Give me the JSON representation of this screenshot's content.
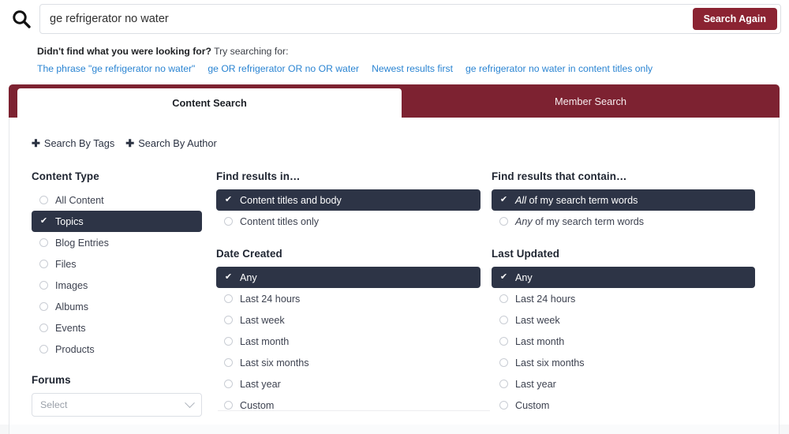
{
  "search": {
    "icon": "search-icon",
    "value": "ge refrigerator no water",
    "placeholder": "Search...",
    "button_label": "Search Again"
  },
  "alt_search": {
    "lead_bold": "Didn't find what you were looking for?",
    "lead_rest": " Try searching for:",
    "links": [
      "The phrase \"ge refrigerator no water\"",
      "ge OR refrigerator OR no OR water",
      "Newest results first",
      "ge refrigerator no water in content titles only"
    ]
  },
  "tabs": [
    {
      "label": "Content Search",
      "active": true
    },
    {
      "label": "Member Search",
      "active": false
    }
  ],
  "quick_links": [
    {
      "icon": "plus-icon",
      "label": "Search By Tags"
    },
    {
      "icon": "plus-icon",
      "label": "Search By Author"
    }
  ],
  "content_type": {
    "title": "Content Type",
    "options": [
      {
        "label": "All Content",
        "selected": false
      },
      {
        "label": "Topics",
        "selected": true
      },
      {
        "label": "Blog Entries",
        "selected": false
      },
      {
        "label": "Files",
        "selected": false
      },
      {
        "label": "Images",
        "selected": false
      },
      {
        "label": "Albums",
        "selected": false
      },
      {
        "label": "Events",
        "selected": false
      },
      {
        "label": "Products",
        "selected": false
      }
    ]
  },
  "forums": {
    "title": "Forums",
    "select_placeholder": "Select",
    "chevron": "chevron-down-icon"
  },
  "find_results_in": {
    "title": "Find results in…",
    "options": [
      {
        "label": "Content titles and body",
        "selected": true
      },
      {
        "label": "Content titles only",
        "selected": false
      }
    ]
  },
  "date_created": {
    "title": "Date Created",
    "options": [
      {
        "label": "Any",
        "selected": true
      },
      {
        "label": "Last 24 hours",
        "selected": false
      },
      {
        "label": "Last week",
        "selected": false
      },
      {
        "label": "Last month",
        "selected": false
      },
      {
        "label": "Last six months",
        "selected": false
      },
      {
        "label": "Last year",
        "selected": false
      },
      {
        "label": "Custom",
        "selected": false
      }
    ]
  },
  "find_results_contain": {
    "title": "Find results that contain…",
    "options": [
      {
        "em": "All",
        "rest": " of my search term words",
        "selected": true
      },
      {
        "em": "Any",
        "rest": " of my search term words",
        "selected": false
      }
    ]
  },
  "last_updated": {
    "title": "Last Updated",
    "options": [
      {
        "label": "Any",
        "selected": true
      },
      {
        "label": "Last 24 hours",
        "selected": false
      },
      {
        "label": "Last week",
        "selected": false
      },
      {
        "label": "Last month",
        "selected": false
      },
      {
        "label": "Last six months",
        "selected": false
      },
      {
        "label": "Last year",
        "selected": false
      },
      {
        "label": "Custom",
        "selected": false
      }
    ]
  },
  "colors": {
    "brand_maroon": "#7d2231",
    "button_maroon": "#8b2332",
    "selected_dark": "#2d3446",
    "link_blue": "#2a84d2"
  }
}
